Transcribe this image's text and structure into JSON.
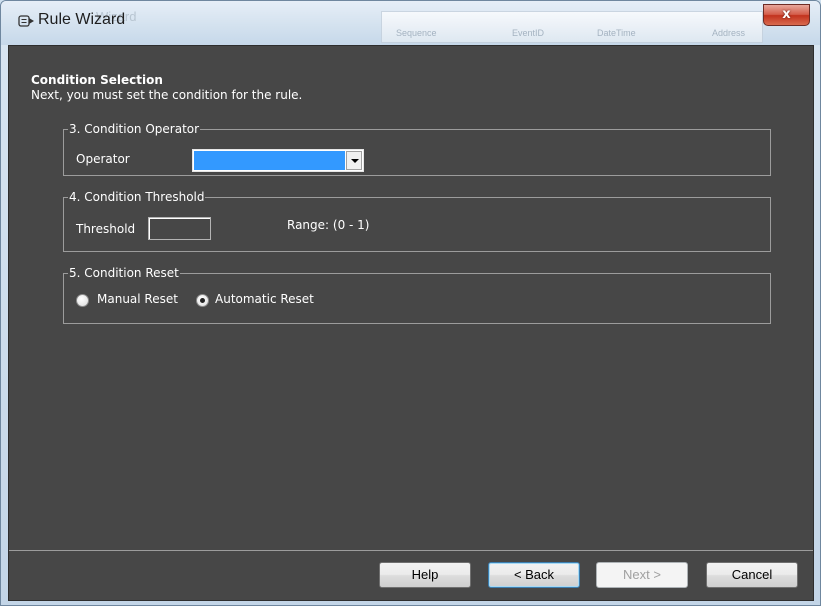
{
  "window": {
    "title": "Rule Wizard",
    "close_label": "x"
  },
  "background_window": {
    "title_blur": "Wizard",
    "columns": [
      "Sequence",
      "EventID",
      "DateTime",
      "Address"
    ]
  },
  "header": {
    "title": "Condition Selection",
    "subtitle": "Next, you must set the condition for the rule."
  },
  "operator_group": {
    "legend": "3. Condition Operator",
    "label": "Operator",
    "selected_value": ""
  },
  "threshold_group": {
    "legend": "4. Condition Threshold",
    "label": "Threshold",
    "value": "",
    "range_text": "Range: (0 - 1)"
  },
  "reset_group": {
    "legend": "5. Condition Reset",
    "options": [
      {
        "label": "Manual Reset",
        "checked": false
      },
      {
        "label": "Automatic Reset",
        "checked": true
      }
    ]
  },
  "buttons": {
    "help": "Help",
    "back": "< Back",
    "next": "Next >",
    "cancel": "Cancel"
  },
  "colors": {
    "client_background": "#474747",
    "selection_blue": "#3399ff",
    "close_red": "#c2321d"
  }
}
